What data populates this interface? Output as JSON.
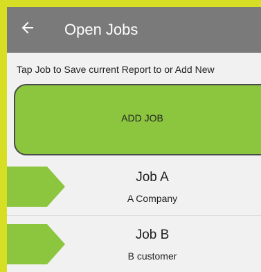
{
  "appbar": {
    "back_icon": "arrow-left-icon",
    "title": "Open Jobs"
  },
  "instruction": "Tap Job to Save current Report to or Add New",
  "add_job": {
    "label": "ADD JOB"
  },
  "jobs": [
    {
      "name": "Job A",
      "customer": "A Company"
    },
    {
      "name": "Job B",
      "customer": "B customer"
    }
  ],
  "colors": {
    "frame": "#d6df23",
    "appbar": "#7a7a7a",
    "accent_green": "#8cc63f",
    "background": "#f1f1f1"
  }
}
